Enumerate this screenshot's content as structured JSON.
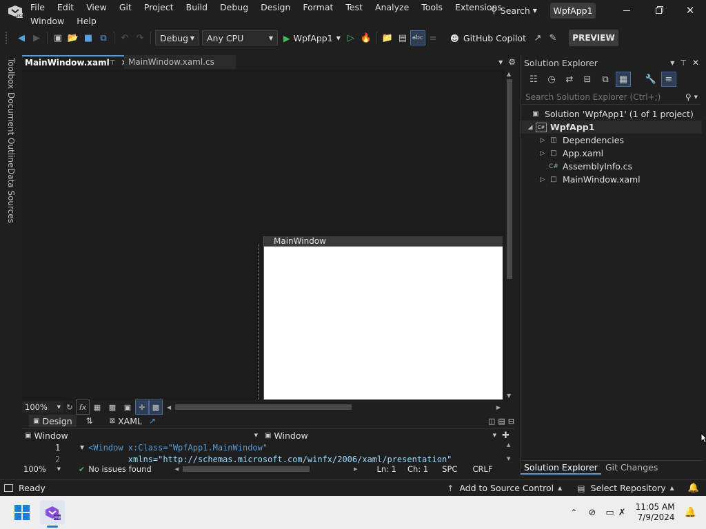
{
  "menu": {
    "row1": [
      "File",
      "Edit",
      "View",
      "Git",
      "Project",
      "Build",
      "Debug",
      "Design",
      "Format",
      "Test",
      "Analyze",
      "Tools",
      "Extensions"
    ],
    "row2": [
      "Window",
      "Help"
    ],
    "search_label": "Search",
    "app_title": "WpfApp1"
  },
  "toolbar": {
    "config": "Debug",
    "platform": "Any CPU",
    "run_label": "WpfApp1",
    "copilot": "GitHub Copilot",
    "preview": "PREVIEW"
  },
  "left_tabs": [
    "Toolbox",
    "Document Outline",
    "Data Sources"
  ],
  "editor": {
    "tabs": [
      {
        "label": "MainWindow.xaml",
        "active": true
      },
      {
        "label": "MainWindow.xaml.cs",
        "active": false
      }
    ],
    "window_title": "MainWindow",
    "zoom": "100%",
    "design_tab": "Design",
    "xaml_tab": "XAML",
    "scope_left": "Window",
    "scope_right": "Window",
    "code_lines": [
      {
        "num": "1",
        "text": "<Window x:Class=\"WpfApp1.MainWindow\""
      },
      {
        "num": "2",
        "text": "        xmlns=\"http://schemas.microsoft.com/winfx/2006/xaml/presentation\""
      }
    ],
    "code_zoom": "100%",
    "issues": "No issues found",
    "ln": "Ln: 1",
    "ch": "Ch: 1",
    "spc": "SPC",
    "crlf": "CRLF"
  },
  "solution_explorer": {
    "title": "Solution Explorer",
    "search_placeholder": "Search Solution Explorer (Ctrl+;)",
    "solution": "Solution 'WpfApp1' (1 of 1 project)",
    "project": "WpfApp1",
    "items": [
      "Dependencies",
      "App.xaml",
      "AssemblyInfo.cs",
      "MainWindow.xaml"
    ],
    "bottom_tabs": [
      "Solution Explorer",
      "Git Changes"
    ]
  },
  "statusbar": {
    "ready": "Ready",
    "source_control": "Add to Source Control",
    "repository": "Select Repository"
  },
  "taskbar": {
    "time": "11:05 AM",
    "date": "7/9/2024"
  }
}
